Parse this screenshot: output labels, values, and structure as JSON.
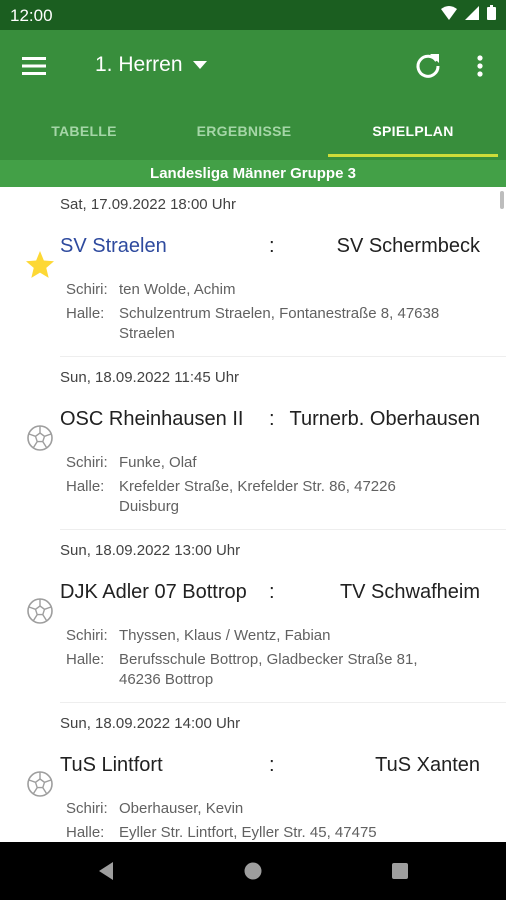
{
  "status_bar": {
    "time": "12:00",
    "icons": [
      "wifi-icon",
      "signal-icon",
      "battery-icon"
    ]
  },
  "app_bar": {
    "team": "1. Herren",
    "menu_icon": "menu-icon",
    "dropdown_icon": "dropdown-arrow-icon",
    "refresh_icon": "refresh-icon",
    "overflow_icon": "more-vert-icon"
  },
  "tabs": [
    {
      "label": "TABELLE",
      "active": false
    },
    {
      "label": "ERGEBNISSE",
      "active": false
    },
    {
      "label": "SPIELPLAN",
      "active": true
    }
  ],
  "league": "Landesliga Männer Gruppe 3",
  "matches": [
    {
      "date": "Sat, 17.09.2022 18:00 Uhr",
      "home": "SV Straelen",
      "separator": ":",
      "away": "SV Schermbeck",
      "favorite": true,
      "icon": "star-icon",
      "referee_label": "Schiri:",
      "referee": "ten Wolde, Achim",
      "hall_label": "Halle:",
      "hall": "Schulzentrum Straelen, Fontanestraße 8, 47638 Straelen"
    },
    {
      "date": "Sun, 18.09.2022 11:45 Uhr",
      "home": "OSC Rheinhausen II",
      "separator": ":",
      "away": "Turnerb. Oberhausen",
      "favorite": false,
      "icon": "ball-icon",
      "referee_label": "Schiri:",
      "referee": "Funke, Olaf",
      "hall_label": "Halle:",
      "hall": "Krefelder Straße, Krefelder Str. 86, 47226 Duisburg"
    },
    {
      "date": "Sun, 18.09.2022 13:00 Uhr",
      "home": "DJK Adler 07 Bottrop",
      "separator": ":",
      "away": "TV Schwafheim",
      "favorite": false,
      "icon": "ball-icon",
      "referee_label": "Schiri:",
      "referee": "Thyssen, Klaus / Wentz, Fabian",
      "hall_label": "Halle:",
      "hall": "Berufsschule Bottrop, Gladbecker Straße 81, 46236 Bottrop"
    },
    {
      "date": "Sun, 18.09.2022 14:00 Uhr",
      "home": "TuS Lintfort",
      "separator": ":",
      "away": "TuS Xanten",
      "favorite": false,
      "icon": "ball-icon",
      "referee_label": "Schiri:",
      "referee": "Oberhauser, Kevin",
      "hall_label": "Halle:",
      "hall": "Eyller Str. Lintfort, Eyller Str. 45, 47475"
    }
  ],
  "nav_bar": {
    "icons": [
      "back-icon",
      "home-icon",
      "recents-icon"
    ]
  },
  "colors": {
    "status_bar": "#1b5e20",
    "app_bar": "#388e3c",
    "league_bar": "#43a047",
    "tab_indicator": "#cddc39",
    "favorite_team": "#2e4a9e",
    "star": "#fdd835"
  }
}
